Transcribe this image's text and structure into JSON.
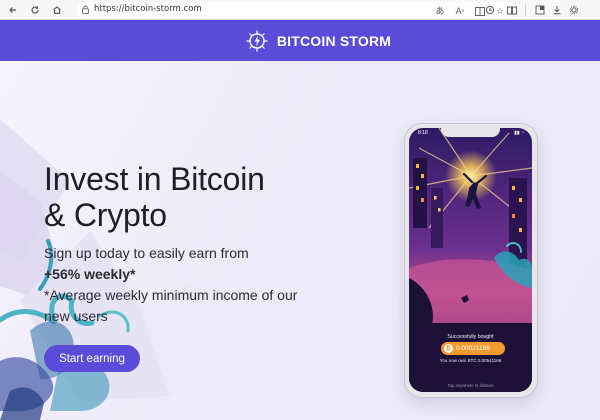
{
  "browser": {
    "url": "https://bitcoin-storm.com",
    "nav_icons": [
      "back-arrow-icon",
      "refresh-icon",
      "home-icon"
    ],
    "toolbar_icons": [
      "translate-icon",
      "read-aloud-icon",
      "split-screen-icon",
      "favorite-star-icon",
      "refresh-page-icon",
      "reading-view-icon",
      "extensions-icon",
      "download-icon",
      "settings-icon"
    ]
  },
  "header": {
    "brand": "BITCOIN STORM",
    "logo_icon": "storm-logo-icon",
    "color": "#5a4bd8"
  },
  "hero": {
    "headline_line1": "Invest in Bitcoin",
    "headline_line2": "& Crypto",
    "sub_line1": "Sign up today to easily earn from",
    "sub_pct": "+56% weekly*",
    "sub_line3": "*Average weekly minimum income of our new users",
    "cta": "Start earning",
    "cta_color": "#5a4bd8"
  },
  "phone": {
    "status_time": "8:18",
    "toast_title": "Successfully bought",
    "amount": "0.00021166",
    "coin_symbol": "₿",
    "owned": "You now own BTC 0.00541166",
    "tap_hint": "Tap anywhere to dismiss",
    "accent": "#f29a2e"
  }
}
